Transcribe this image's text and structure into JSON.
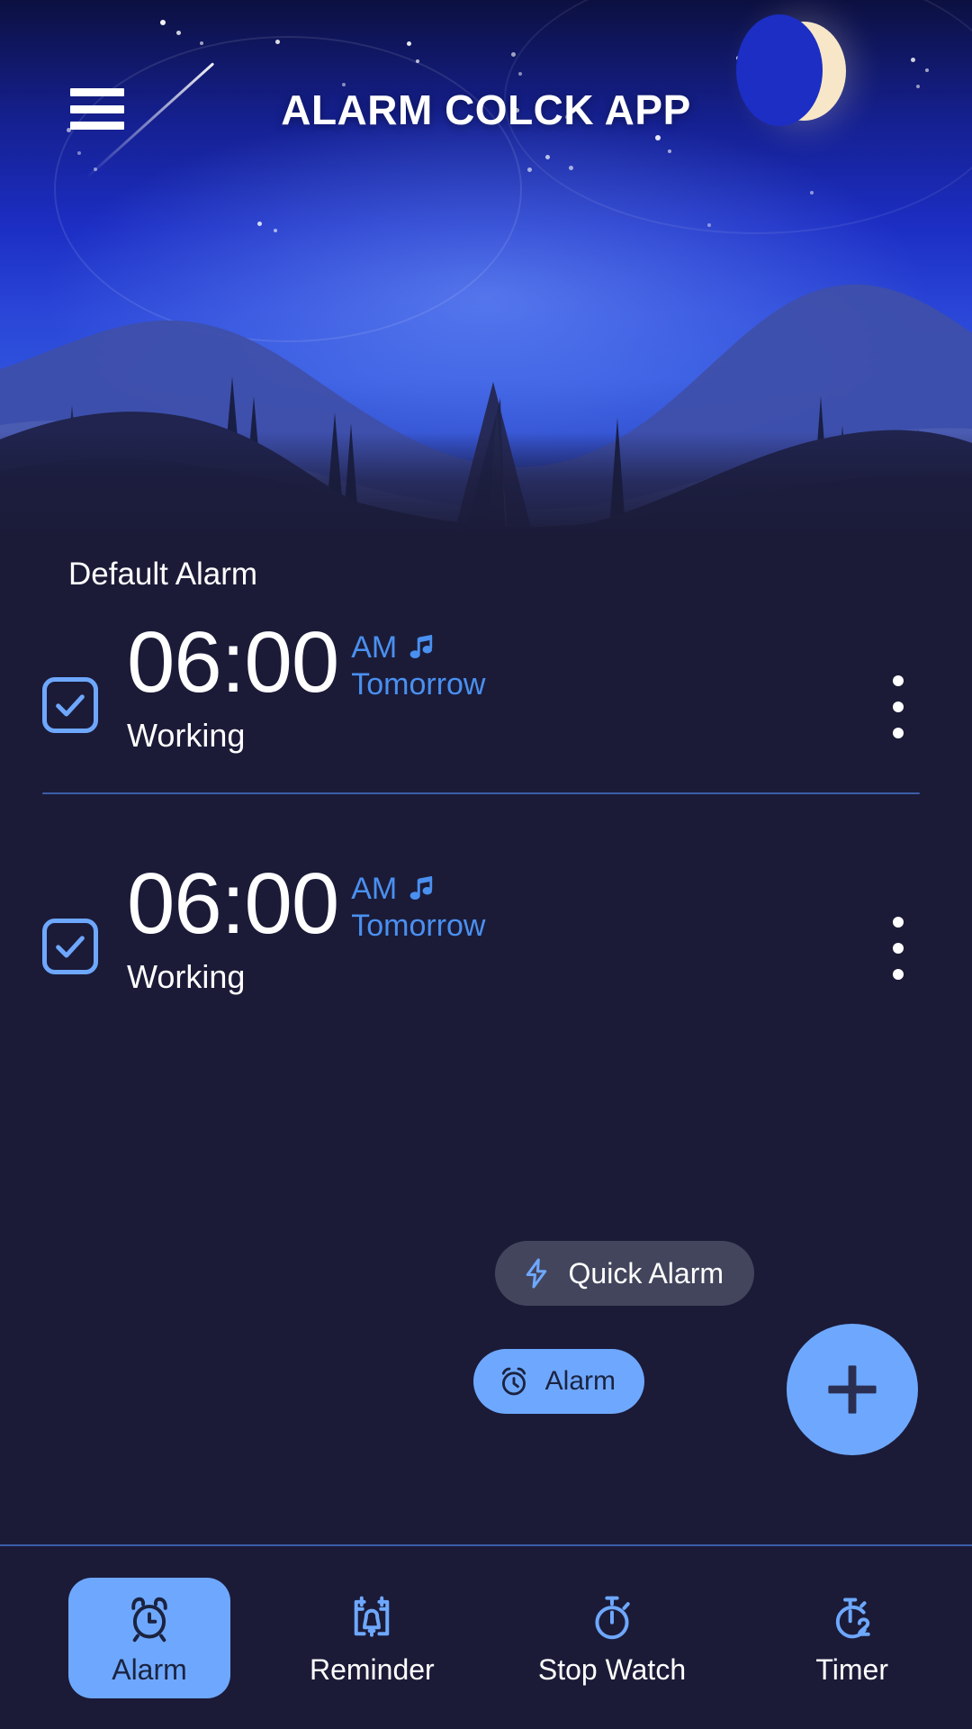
{
  "header": {
    "title": "ALARM COLCK APP",
    "menu_icon": "hamburger-menu-icon",
    "moon_icon": "crescent-moon-icon"
  },
  "theme": {
    "accent_blue": "#6ea8fe",
    "link_blue": "#4a90f0",
    "page_bg": "#1b1b38",
    "divider": "#3c5ea8",
    "moon_cream": "#f7e7c8",
    "text_white": "#ffffff",
    "dark_on_accent": "#1b2340"
  },
  "list": {
    "section_label": "Default Alarm",
    "alarms": [
      {
        "enabled": true,
        "time": "06:00",
        "meridiem": "AM",
        "when": "Tomorrow",
        "label": "Working",
        "sound_icon": "music-note-icon",
        "menu_icon": "kebab-menu-icon"
      },
      {
        "enabled": true,
        "time": "06:00",
        "meridiem": "AM",
        "when": "Tomorrow",
        "label": "Working",
        "sound_icon": "music-note-icon",
        "menu_icon": "kebab-menu-icon"
      }
    ]
  },
  "fab": {
    "quick_alarm_label": "Quick Alarm",
    "quick_alarm_icon": "lightning-bolt-icon",
    "alarm_label": "Alarm",
    "alarm_icon": "alarm-clock-icon",
    "add_icon": "plus-icon"
  },
  "bottom_nav": {
    "items": [
      {
        "label": "Alarm",
        "icon": "alarm-clock-icon",
        "active": true
      },
      {
        "label": "Reminder",
        "icon": "calendar-bell-icon",
        "active": false
      },
      {
        "label": "Stop Watch",
        "icon": "stopwatch-icon",
        "active": false
      },
      {
        "label": "Timer",
        "icon": "timer-2-icon",
        "active": false
      }
    ]
  }
}
